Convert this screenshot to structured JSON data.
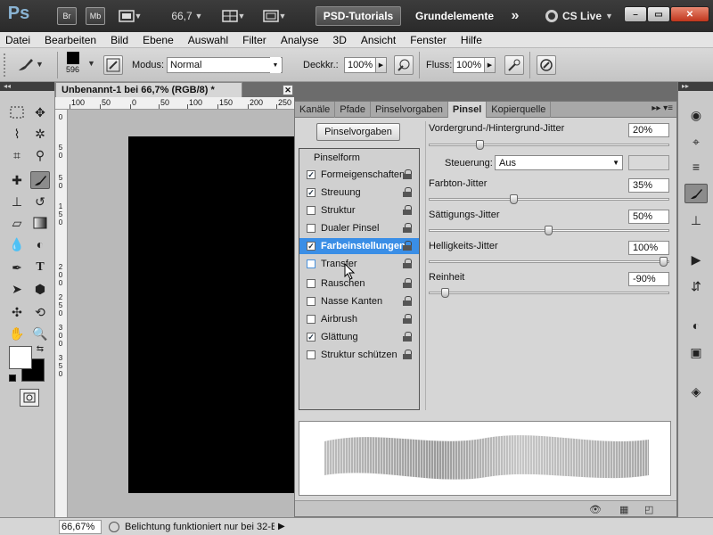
{
  "titlebar": {
    "logo": "Ps",
    "bridge_btn": "Br",
    "minibridge_btn": "Mb",
    "zoom": "66,7",
    "psd_tab": "PSD-Tutorials",
    "workspace": "Grundelemente",
    "more": "»",
    "cslive": "CS Live",
    "min": "–",
    "max": "▭",
    "close": "✕"
  },
  "menu": [
    "Datei",
    "Bearbeiten",
    "Bild",
    "Ebene",
    "Auswahl",
    "Filter",
    "Analyse",
    "3D",
    "Ansicht",
    "Fenster",
    "Hilfe"
  ],
  "options": {
    "brush_size": "596",
    "modus_label": "Modus:",
    "modus_value": "Normal",
    "deckkr_label": "Deckkr.:",
    "deckkr_value": "100%",
    "fluss_label": "Fluss:",
    "fluss_value": "100%"
  },
  "document": {
    "tab_title": "Unbenannt-1 bei 66,7% (RGB/8) *",
    "close": "✕",
    "ruler_top": [
      "100",
      "50",
      "0",
      "50",
      "100",
      "150",
      "200",
      "250"
    ],
    "ruler_left": [
      "0",
      "5",
      "0",
      "5",
      "0",
      "1",
      "5",
      "0",
      "2",
      "0",
      "0",
      "2",
      "5",
      "0",
      "3",
      "0",
      "0",
      "3",
      "5",
      "0"
    ]
  },
  "panel": {
    "tabs": [
      "Kanäle",
      "Pfade",
      "Pinselvorgaben",
      "Pinsel",
      "Kopierquelle"
    ],
    "active_tab": "Pinsel",
    "controls": "▸▸ ▾≡",
    "preset_button": "Pinselvorgaben",
    "list_header": "Pinselform",
    "list": [
      {
        "label": "Formeigenschaften",
        "checked": true
      },
      {
        "label": "Streuung",
        "checked": true
      },
      {
        "label": "Struktur",
        "checked": false
      },
      {
        "label": "Dualer Pinsel",
        "checked": false
      },
      {
        "label": "Farbeinstellungen",
        "checked": true,
        "selected": true
      },
      {
        "label": "Transfer",
        "checked": false
      },
      {
        "label": "Rauschen",
        "checked": false
      },
      {
        "label": "Nasse Kanten",
        "checked": false
      },
      {
        "label": "Airbrush",
        "checked": false
      },
      {
        "label": "Glättung",
        "checked": true
      },
      {
        "label": "Struktur schützen",
        "checked": false
      }
    ],
    "settings": {
      "vh_jitter_label": "Vordergrund-/Hintergrund-Jitter",
      "vh_jitter_value": "20%",
      "vh_jitter_level": 20,
      "steuerung_label": "Steuerung:",
      "steuerung_value": "Aus",
      "farbton_label": "Farbton-Jitter",
      "farbton_value": "35%",
      "farbton_level": 35,
      "saett_label": "Sättigungs-Jitter",
      "saett_value": "50%",
      "saett_level": 50,
      "hell_label": "Helligkeits-Jitter",
      "hell_value": "100%",
      "hell_level": 100,
      "rein_label": "Reinheit",
      "rein_value": "-90%",
      "rein_level": 5
    }
  },
  "status": {
    "zoom": "66,67%",
    "text": "Belichtung funktioniert nur bei 32-Bit",
    "arrow": "▶"
  },
  "colors": {
    "accent_selected": "#3a8ee6",
    "canvas": "#000000",
    "foreground": "#000000",
    "background": "#ffffff"
  }
}
